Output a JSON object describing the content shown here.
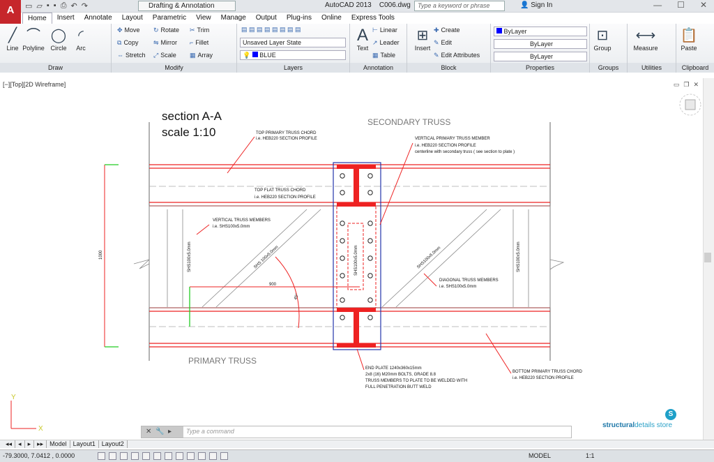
{
  "titlebar": {
    "workspace": "Drafting & Annotation",
    "app_title": "AutoCAD 2013",
    "file": "C006.dwg",
    "search_placeholder": "Type a keyword or phrase",
    "signin": "Sign In",
    "app_letter": "A"
  },
  "tabs": [
    "Home",
    "Insert",
    "Annotate",
    "Layout",
    "Parametric",
    "View",
    "Manage",
    "Output",
    "Plug-ins",
    "Online",
    "Express Tools"
  ],
  "draw": {
    "title": "Draw",
    "line": "Line",
    "polyline": "Polyline",
    "circle": "Circle",
    "arc": "Arc"
  },
  "modify": {
    "title": "Modify",
    "move": "Move",
    "rotate": "Rotate",
    "trim": "Trim",
    "copy": "Copy",
    "mirror": "Mirror",
    "fillet": "Fillet",
    "stretch": "Stretch",
    "scale": "Scale",
    "array": "Array"
  },
  "layers": {
    "title": "Layers",
    "state": "Unsaved Layer State",
    "current": "BLUE"
  },
  "annotation": {
    "title": "Annotation",
    "text": "Text",
    "linear": "Linear",
    "leader": "Leader",
    "table": "Table"
  },
  "block": {
    "title": "Block",
    "insert": "Insert",
    "create": "Create",
    "edit": "Edit",
    "edit_attr": "Edit Attributes"
  },
  "properties": {
    "title": "Properties",
    "color": "ByLayer",
    "linetype": "ByLayer",
    "lineweight": "ByLayer"
  },
  "groups": {
    "title": "Groups",
    "group": "Group"
  },
  "utilities": {
    "title": "Utilities",
    "measure": "Measure"
  },
  "clipboard": {
    "title": "Clipboard",
    "paste": "Paste"
  },
  "viewport": {
    "label": "[−][Top][2D Wireframe]"
  },
  "drawing": {
    "section": "section A-A",
    "scale": "scale 1:10",
    "secondary": "SECONDARY TRUSS",
    "primary": "PRIMARY TRUSS",
    "top_chord_1": "TOP PRIMARY TRUSS CHORD",
    "top_chord_2": "i.e. HEB220 SECTION PROFILE",
    "vert_member_1": "VERTICAL PRIMARY TRUSS MEMBER",
    "vert_member_2": "i.e. HEB220 SECTION PROFILE",
    "vert_member_3": "centerline with secondary truss ( see section to plate )",
    "flat_chord_1": "TOP FLAT TRUSS CHORD",
    "flat_chord_2": "i.e. HEB220 SECTION PROFILE",
    "vert_truss_1": "VERTICAL TRUSS MEMBERS",
    "vert_truss_2": "i.e. SHS100x5.0mm",
    "diag_1": "DIAGONAL TRUSS MEMBERS",
    "diag_2": "i.e. SHS100x5.0mm",
    "end_1": "END PLATE 1240x360x15mm",
    "end_2": "2x8 (16) M20mm BOLTS, GRADE 8.8",
    "end_3": "TRUSS MEMBERS TO PLATE TO BE WELDED WITH",
    "end_4": "FULL PENETRATION BUTT WELD",
    "bottom_1": "BOTTOM PRIMARY TRUSS CHORD",
    "bottom_2": "i.e. HEB220 SECTION PROFILE",
    "dim_height": "1000",
    "dim_width": "900",
    "angle": "45°",
    "shs_a": "SHS 100x5.0mm",
    "shs_b": "SHS100x5.0mm"
  },
  "command": {
    "placeholder": "Type a command"
  },
  "brand": {
    "a": "structural",
    "b": "details store",
    "logo": "S"
  },
  "layout_tabs": [
    "Model",
    "Layout1",
    "Layout2"
  ],
  "status": {
    "coords": "-79.3000, 7.0412 , 0.0000",
    "model": "MODEL",
    "scale": "1:1"
  }
}
